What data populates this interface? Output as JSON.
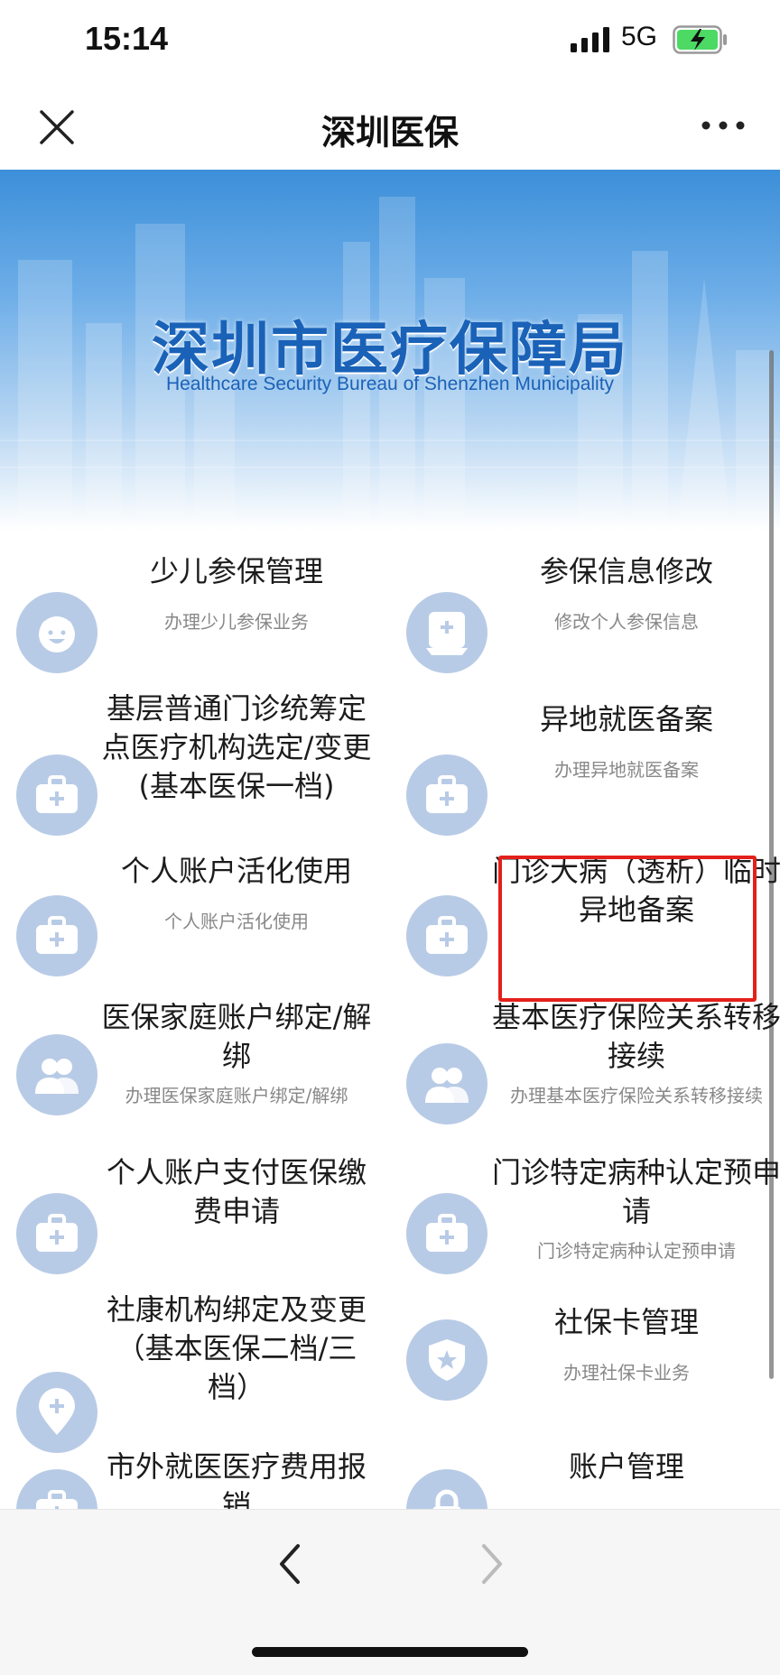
{
  "status_bar": {
    "time": "15:14",
    "network": "5G",
    "battery_color": "#4cd964"
  },
  "nav": {
    "title": "深圳医保",
    "close_icon": "close-icon",
    "more_icon": "more-dots-icon"
  },
  "banner": {
    "title": "深圳市医疗保障局",
    "subtitle": "Healthcare Security Bureau of Shenzhen Municipality",
    "colors": {
      "top": "#3c8fd9",
      "bottom": "#ffffff",
      "title": "#1a62b8"
    }
  },
  "services": [
    {
      "title": "少儿参保管理",
      "desc": "办理少儿参保业务",
      "icon": "child-face-icon"
    },
    {
      "title": "参保信息修改",
      "desc": "修改个人参保信息",
      "icon": "edit-card-icon"
    },
    {
      "title": "基层普通门诊统筹定点医疗机构选定/变更(基本医保一档)",
      "desc": "",
      "icon": "medical-kit-icon"
    },
    {
      "title": "异地就医备案",
      "desc": "办理异地就医备案",
      "icon": "medical-kit-icon",
      "highlighted": true
    },
    {
      "title": "个人账户活化使用",
      "desc": "个人账户活化使用",
      "icon": "medical-kit-icon"
    },
    {
      "title": "门诊大病（透析）临时异地备案",
      "desc": "",
      "icon": "medical-kit-icon"
    },
    {
      "title": "医保家庭账户绑定/解绑",
      "desc": "办理医保家庭账户绑定/解绑",
      "icon": "family-icon"
    },
    {
      "title": "基本医疗保险关系转移接续",
      "desc": "办理基本医疗保险关系转移接续",
      "icon": "family-icon"
    },
    {
      "title": "个人账户支付医保缴费申请",
      "desc": "",
      "icon": "medical-kit-icon"
    },
    {
      "title": "门诊特定病种认定预申请",
      "desc": "门诊特定病种认定预申请",
      "icon": "medical-kit-icon"
    },
    {
      "title": "社康机构绑定及变更（基本医保二档/三档）",
      "desc": "",
      "icon": "location-plus-icon"
    },
    {
      "title": "社保卡管理",
      "desc": "办理社保卡业务",
      "icon": "shield-star-icon"
    },
    {
      "title": "市外就医医疗费用报销",
      "desc": "",
      "icon": "medical-kit-icon"
    },
    {
      "title": "账户管理",
      "desc": "",
      "icon": "lock-icon"
    }
  ],
  "toolbar": {
    "back_icon": "chevron-left-icon",
    "forward_icon": "chevron-right-icon"
  },
  "icon_bg_color": "#b8cbe6",
  "highlight_color": "#e3201b"
}
